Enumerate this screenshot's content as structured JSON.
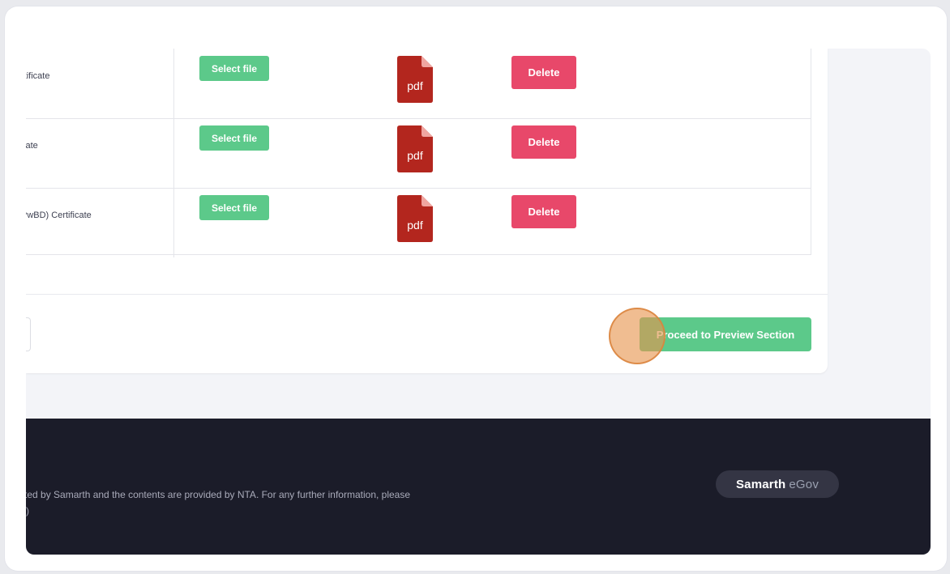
{
  "documents": [
    {
      "name": "rtificate",
      "select_label": "Select file",
      "file_icon": "pdf-icon",
      "file_type": "pdf",
      "delete_label": "Delete"
    },
    {
      "name": "cate",
      "select_label": "Select file",
      "file_icon": "pdf-icon",
      "file_type": "pdf",
      "delete_label": "Delete"
    },
    {
      "name": "PwBD) Certificate",
      "select_label": "Select file",
      "file_icon": "pdf-icon",
      "file_type": "pdf",
      "delete_label": "Delete"
    }
  ],
  "actions": {
    "proceed_label": "Proceed to Preview Section"
  },
  "footer": {
    "text_line1": "sted by Samarth and the contents are provided by NTA. For any further information, please",
    "text_line2": ")",
    "brand_part1": "Samarth",
    "brand_part2": "eGov"
  },
  "colors": {
    "select_button": "#5cc98a",
    "delete_button": "#e8486a",
    "pdf_icon": "#b3261e",
    "footer_bg": "#1b1c29",
    "click_indicator": "#e7954d"
  }
}
